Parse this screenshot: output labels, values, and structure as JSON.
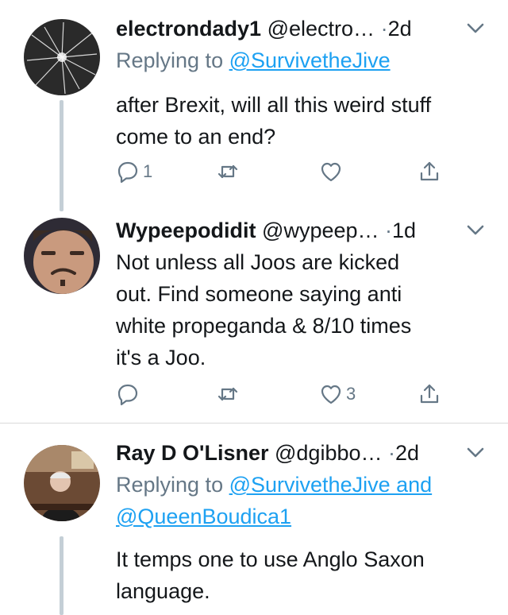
{
  "tweets": [
    {
      "name": "electrondady1",
      "handle": "@electro…",
      "separator": "·",
      "time": "2d",
      "reply_prefix": "Replying to",
      "reply_to_1": "@SurvivetheJive",
      "reply_to_2": "",
      "text_lines": [
        "after Brexit, will all this weird stuff",
        "come to an end?"
      ],
      "reply_count": "1",
      "retweet_count": "",
      "like_count": ""
    },
    {
      "name": "Wypeepodidit",
      "handle": "@wypeep…",
      "separator": "·",
      "time": "1d",
      "text_lines": [
        "Not unless all Joos are kicked",
        "out. Find someone saying anti",
        "white propeganda & 8/10 times",
        "it's a Joo."
      ],
      "reply_count": "",
      "retweet_count": "",
      "like_count": "3"
    },
    {
      "name": "Ray D O'Lisner",
      "handle": "@dgibbo…",
      "separator": "·",
      "time": "2d",
      "reply_prefix": "Replying to",
      "reply_to_1": "@SurvivetheJive and",
      "reply_to_2": "@QueenBoudica1",
      "text_lines": [
        "It temps one to use Anglo Saxon",
        "language."
      ]
    }
  ],
  "colors": {
    "accent": "#1da1f2",
    "secondary": "#657786",
    "thread": "#c4cfd6",
    "divider": "#d9d9d9"
  }
}
